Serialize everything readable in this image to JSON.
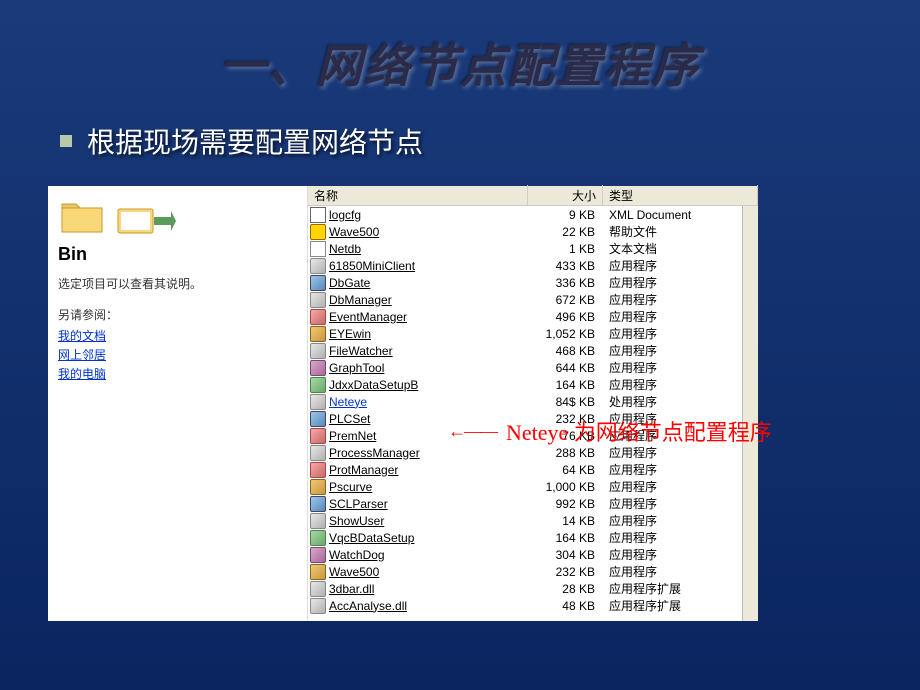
{
  "slide": {
    "title": "一、网络节点配置程序",
    "bullet": "根据现场需要配置网络节点"
  },
  "sidebar": {
    "folder_name": "Bin",
    "description": "选定项目可以查看其说明。",
    "also_see": "另请参阅：",
    "links": [
      "我的文档",
      "网上邻居",
      "我的电脑"
    ]
  },
  "headers": {
    "name": "名称",
    "size": "大小",
    "type": "类型"
  },
  "annotation": {
    "arrow": "←——",
    "text": "Neteye 为网络节点配置程序"
  },
  "files": [
    {
      "name": "logcfg",
      "size": "9 KB",
      "type": "XML Document",
      "icon": "ic-doc"
    },
    {
      "name": "Wave500",
      "size": "22 KB",
      "type": "帮助文件",
      "icon": "ic-help"
    },
    {
      "name": "Netdb",
      "size": "1 KB",
      "type": "文本文档",
      "icon": "ic-txt"
    },
    {
      "name": "61850MiniClient",
      "size": "433 KB",
      "type": "应用程序",
      "icon": "ic-app"
    },
    {
      "name": "DbGate",
      "size": "336 KB",
      "type": "应用程序",
      "icon": "ic-app2"
    },
    {
      "name": "DbManager",
      "size": "672 KB",
      "type": "应用程序",
      "icon": "ic-app"
    },
    {
      "name": "EventManager",
      "size": "496 KB",
      "type": "应用程序",
      "icon": "ic-app6"
    },
    {
      "name": "EYEwin",
      "size": "1,052 KB",
      "type": "应用程序",
      "icon": "ic-app3"
    },
    {
      "name": "FileWatcher",
      "size": "468 KB",
      "type": "应用程序",
      "icon": "ic-app"
    },
    {
      "name": "GraphTool",
      "size": "644 KB",
      "type": "应用程序",
      "icon": "ic-app4"
    },
    {
      "name": "JdxxDataSetupB",
      "size": "164 KB",
      "type": "应用程序",
      "icon": "ic-app5"
    },
    {
      "name": "Neteye",
      "size": "84$ KB",
      "type": "处用程序",
      "icon": "ic-app",
      "highlighted": true
    },
    {
      "name": "PLCSet",
      "size": "232 KB",
      "type": "应用程序",
      "icon": "ic-app2"
    },
    {
      "name": "PremNet",
      "size": "76 KB",
      "type": "应用程序",
      "icon": "ic-app6"
    },
    {
      "name": "ProcessManager",
      "size": "288 KB",
      "type": "应用程序",
      "icon": "ic-app"
    },
    {
      "name": "ProtManager",
      "size": "64 KB",
      "type": "应用程序",
      "icon": "ic-app6"
    },
    {
      "name": "Pscurve",
      "size": "1,000 KB",
      "type": "应用程序",
      "icon": "ic-app3"
    },
    {
      "name": "SCLParser",
      "size": "992 KB",
      "type": "应用程序",
      "icon": "ic-app2"
    },
    {
      "name": "ShowUser",
      "size": "14 KB",
      "type": "应用程序",
      "icon": "ic-app"
    },
    {
      "name": "VqcBDataSetup",
      "size": "164 KB",
      "type": "应用程序",
      "icon": "ic-app5"
    },
    {
      "name": "WatchDog",
      "size": "304 KB",
      "type": "应用程序",
      "icon": "ic-app4"
    },
    {
      "name": "Wave500",
      "size": "232 KB",
      "type": "应用程序",
      "icon": "ic-app3"
    },
    {
      "name": "3dbar.dll",
      "size": "28 KB",
      "type": "应用程序扩展",
      "icon": "ic-app"
    },
    {
      "name": "AccAnalyse.dll",
      "size": "48 KB",
      "type": "应用程序扩展",
      "icon": "ic-app"
    }
  ]
}
